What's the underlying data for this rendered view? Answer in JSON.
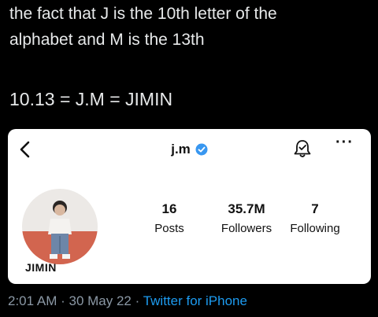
{
  "tweet": {
    "line1": "the fact that J is the 10th letter of the",
    "line2": "alphabet and M is the 13th",
    "line3": "10.13  = J.M = JIMIN"
  },
  "profile": {
    "username": "j.m",
    "display_name": "JIMIN",
    "posts_count": "16",
    "posts_label": "Posts",
    "followers_count": "35.7M",
    "followers_label": "Followers",
    "following_count": "7",
    "following_label": "Following",
    "more_label": "···",
    "icons": [
      "back-icon",
      "verified-icon",
      "bell-icon",
      "more-icon"
    ],
    "verified_color": "#3897f0"
  },
  "meta": {
    "time": "2:01 AM",
    "sep1": " · ",
    "date": "30 May 22",
    "sep2": " · ",
    "source": "Twitter for iPhone"
  }
}
